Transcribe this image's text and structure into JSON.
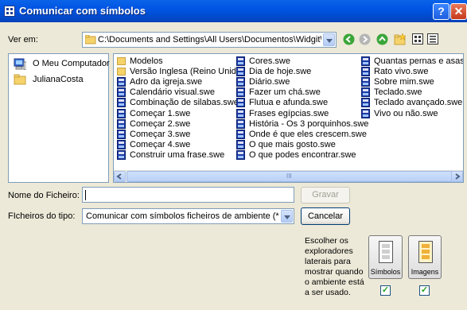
{
  "window": {
    "title": "Comunicar com símbolos",
    "help_label": "?",
    "close_label": "✕"
  },
  "lookin": {
    "label": "Ver em:",
    "path": "C:\\Documents and Settings\\All Users\\Documentos\\Widgit\\Comunicar com Sín"
  },
  "places": [
    {
      "label": "O Meu Computador",
      "icon": "my-computer-icon"
    },
    {
      "label": "JulianaCosta",
      "icon": "folder-icon"
    }
  ],
  "files": {
    "col1": [
      {
        "name": "Modelos",
        "type": "folder"
      },
      {
        "name": "Versão Inglesa (Reino Unido)",
        "type": "folder"
      },
      {
        "name": "Adro da igreja.swe",
        "type": "swe"
      },
      {
        "name": "Calendário visual.swe",
        "type": "swe"
      },
      {
        "name": "Combinação de silabas.swe",
        "type": "swe"
      },
      {
        "name": "Começar 1.swe",
        "type": "swe"
      },
      {
        "name": "Começar 2.swe",
        "type": "swe"
      },
      {
        "name": "Começar 3.swe",
        "type": "swe"
      },
      {
        "name": "Começar 4.swe",
        "type": "swe"
      },
      {
        "name": "Construir uma frase.swe",
        "type": "swe"
      }
    ],
    "col2": [
      {
        "name": "Cores.swe",
        "type": "swe"
      },
      {
        "name": "Dia de hoje.swe",
        "type": "swe"
      },
      {
        "name": "Diário.swe",
        "type": "swe"
      },
      {
        "name": "Fazer um chá.swe",
        "type": "swe"
      },
      {
        "name": "Flutua e afunda.swe",
        "type": "swe"
      },
      {
        "name": "Frases egípcias.swe",
        "type": "swe"
      },
      {
        "name": "História - Os 3 porquinhos.swe",
        "type": "swe"
      },
      {
        "name": "Onde é que eles crescem.swe",
        "type": "swe"
      },
      {
        "name": "O que mais gosto.swe",
        "type": "swe"
      },
      {
        "name": "O que podes encontrar.swe",
        "type": "swe"
      }
    ],
    "col3": [
      {
        "name": "Quantas pernas e asas.swe",
        "type": "swe"
      },
      {
        "name": "Rato vivo.swe",
        "type": "swe"
      },
      {
        "name": "Sobre mim.swe",
        "type": "swe"
      },
      {
        "name": "Teclado.swe",
        "type": "swe"
      },
      {
        "name": "Teclado avançado.swe",
        "type": "swe"
      },
      {
        "name": "Vivo ou não.swe",
        "type": "swe"
      }
    ]
  },
  "scrollbar": {
    "grip": "III"
  },
  "filename": {
    "label": "Nome do Ficheiro:",
    "value": ""
  },
  "filetype": {
    "label": "FIcheiros do tipo:",
    "value": "Comunicar com símbolos ficheiros de ambiente (*.swe)"
  },
  "buttons": {
    "save": "Gravar",
    "cancel": "Cancelar"
  },
  "explorers": {
    "description": "Escolher os exploradores laterais para mostrar quando o ambiente está a ser usado.",
    "symbols": {
      "label": "Símbolos",
      "checked": true
    },
    "images": {
      "label": "Imagens",
      "checked": true
    },
    "check_mark": "✓"
  },
  "colors": {
    "title_bar": "#0054E3",
    "dialog_bg": "#ECE9D8",
    "swe_icon": "#1b3aa6",
    "folder": "#F5D36A"
  }
}
